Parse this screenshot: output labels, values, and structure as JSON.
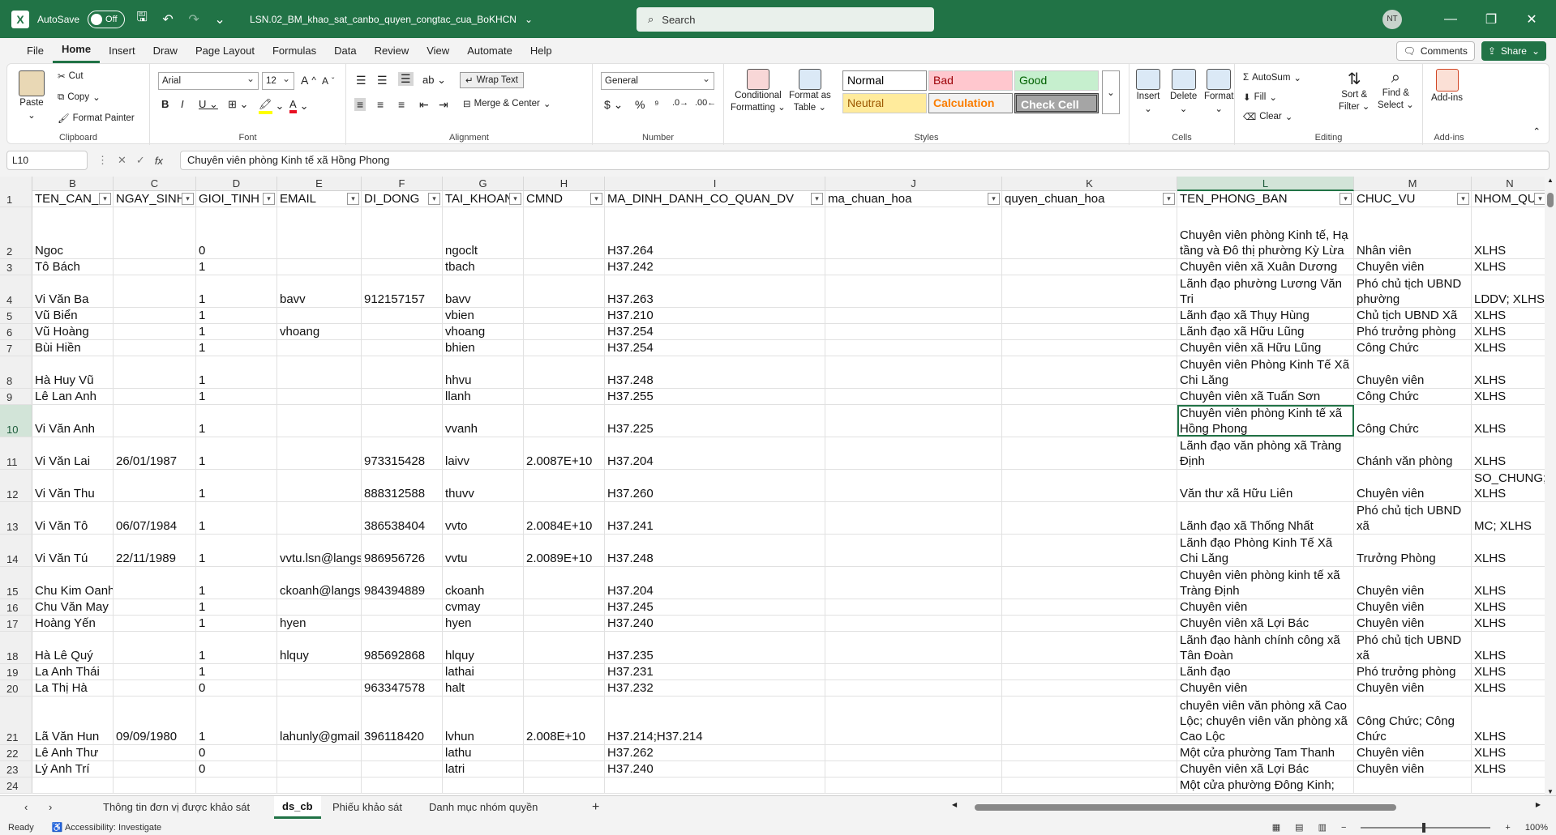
{
  "titlebar": {
    "autosave_label": "AutoSave",
    "autosave_state": "Off",
    "filename": "LSN.02_BM_khao_sat_canbo_quyen_congtac_cua_BoKHCN",
    "search_placeholder": "Search",
    "user_initials": "NT"
  },
  "menu": [
    "File",
    "Home",
    "Insert",
    "Draw",
    "Page Layout",
    "Formulas",
    "Data",
    "Review",
    "View",
    "Automate",
    "Help"
  ],
  "menu_right": {
    "comments": "Comments",
    "share": "Share"
  },
  "ribbon": {
    "clipboard": {
      "paste": "Paste",
      "cut": "Cut",
      "copy": "Copy",
      "format_painter": "Format Painter",
      "label": "Clipboard"
    },
    "font": {
      "name": "Arial",
      "size": "12",
      "label": "Font"
    },
    "alignment": {
      "wrap": "Wrap Text",
      "merge": "Merge & Center",
      "label": "Alignment"
    },
    "number": {
      "format": "General",
      "label": "Number"
    },
    "styles": {
      "conditional": "Conditional",
      "conditional2": "Formatting",
      "format_table": "Format as",
      "format_table2": "Table",
      "normal": "Normal",
      "bad": "Bad",
      "good": "Good",
      "neutral": "Neutral",
      "calculation": "Calculation",
      "check": "Check Cell",
      "label": "Styles"
    },
    "cells": {
      "insert": "Insert",
      "delete": "Delete",
      "format": "Format",
      "label": "Cells"
    },
    "editing": {
      "autosum": "AutoSum",
      "fill": "Fill",
      "clear": "Clear",
      "sort": "Sort &",
      "sort2": "Filter",
      "find": "Find &",
      "find2": "Select",
      "label": "Editing"
    },
    "addins": {
      "addins": "Add-ins",
      "label": "Add-ins"
    },
    "colors": {
      "font_color": "#e81123",
      "highlight": "#ffff00"
    }
  },
  "formula_bar": {
    "name_box": "L10",
    "content": "Chuyên viên phòng Kinh tế xã Hồng Phong"
  },
  "columns": [
    "B",
    "C",
    "D",
    "E",
    "F",
    "G",
    "H",
    "I",
    "J",
    "K",
    "L",
    "M",
    "N"
  ],
  "headers": [
    "TEN_CAN_",
    "NGAY_SINH",
    "GIOI_TINH",
    "EMAIL",
    "DI_DONG",
    "TAI_KHOAN",
    "CMND",
    "MA_DINH_DANH_CO_QUAN_DV",
    "ma_chuan_hoa",
    "quyen_chuan_hoa",
    "TEN_PHONG_BAN",
    "CHUC_VU",
    "NHOM_QU"
  ],
  "rows": [
    {
      "n": "2",
      "c": [
        "Ngoc",
        "",
        "0",
        "",
        "",
        "ngoclt",
        "",
        "H37.264",
        "",
        "",
        "Chuyên viên phòng Kinh tế, Hạ tầng và Đô thị phường Kỳ Lừa",
        "Nhân viên",
        "XLHS"
      ]
    },
    {
      "n": "3",
      "c": [
        "Tô Bách",
        "",
        "1",
        "",
        "",
        "tbach",
        "",
        "H37.242",
        "",
        "",
        "Chuyên viên xã Xuân Dương",
        "Chuyên viên",
        "XLHS"
      ]
    },
    {
      "n": "4",
      "c": [
        "Vi Văn Ba",
        "",
        "1",
        "bavv",
        "912157157",
        "bavv",
        "",
        "H37.263",
        "",
        "",
        "Lãnh đạo phường Lương Văn Tri",
        "Phó chủ tịch UBND phường",
        "LDDV; XLHS"
      ]
    },
    {
      "n": "5",
      "c": [
        "Vũ Biển",
        "",
        "1",
        "",
        "",
        "vbien",
        "",
        "H37.210",
        "",
        "",
        "Lãnh đạo xã Thụy Hùng",
        "Chủ tịch UBND Xã",
        "XLHS"
      ]
    },
    {
      "n": "6",
      "c": [
        "Vũ Hoàng",
        "",
        "1",
        "vhoang",
        "",
        "vhoang",
        "",
        "H37.254",
        "",
        "",
        "Lãnh đạo xã Hữu Lũng",
        "Phó trưởng phòng",
        "XLHS"
      ]
    },
    {
      "n": "7",
      "c": [
        "Bùi Hiền",
        "",
        "1",
        "",
        "",
        "bhien",
        "",
        "H37.254",
        "",
        "",
        "Chuyên viên xã Hữu Lũng",
        "Công Chức",
        "XLHS"
      ]
    },
    {
      "n": "8",
      "c": [
        "Hà Huy Vũ",
        "",
        "1",
        "",
        "",
        "hhvu",
        "",
        "H37.248",
        "",
        "",
        "Chuyên viên Phòng Kinh Tế Xã Chi Lăng",
        "Chuyên viên",
        "XLHS"
      ]
    },
    {
      "n": "9",
      "c": [
        "Lê Lan Anh",
        "",
        "1",
        "",
        "",
        "llanh",
        "",
        "H37.255",
        "",
        "",
        "Chuyên viên xã Tuấn Sơn",
        "Công Chức",
        "XLHS"
      ]
    },
    {
      "n": "10",
      "c": [
        "Vi Văn Anh",
        "",
        "1",
        "",
        "",
        "vvanh",
        "",
        "H37.225",
        "",
        "",
        "Chuyên viên phòng Kinh tế xã Hồng Phong",
        "Công Chức",
        "XLHS"
      ]
    },
    {
      "n": "11",
      "c": [
        "Vi Văn Lai",
        "26/01/1987",
        "1",
        "",
        "973315428",
        "laivv",
        "2.0087E+10",
        "H37.204",
        "",
        "",
        "Lãnh đạo văn phòng xã Tràng Định",
        "Chánh văn phòng",
        "XLHS"
      ]
    },
    {
      "n": "12",
      "c": [
        "Vi Văn Thu",
        "",
        "1",
        "",
        "888312588",
        "thuvv",
        "",
        "H37.260",
        "",
        "",
        "Văn thư xã Hữu Liên",
        "Chuyên viên",
        "SO_CHUNG; XLHS"
      ]
    },
    {
      "n": "13",
      "c": [
        "Vi Văn Tô",
        "06/07/1984",
        "1",
        "",
        "386538404",
        "vvto",
        "2.0084E+10",
        "H37.241",
        "",
        "",
        "Lãnh đạo xã Thống Nhất",
        "Phó chủ tịch UBND xã",
        "MC; XLHS"
      ]
    },
    {
      "n": "14",
      "c": [
        "Vi Văn Tú",
        "22/11/1989",
        "1",
        "vvtu.lsn@langson",
        "986956726",
        "vvtu",
        "2.0089E+10",
        "H37.248",
        "",
        "",
        "Lãnh đạo Phòng Kinh Tế Xã Chi Lăng",
        "Trưởng Phòng",
        "XLHS"
      ]
    },
    {
      "n": "15",
      "c": [
        "Chu Kim Oanh",
        "",
        "1",
        "ckoanh@langson",
        "984394889",
        "ckoanh",
        "",
        "H37.204",
        "",
        "",
        "Chuyên viên phòng kinh tế xã Tràng Định",
        "Chuyên viên",
        "XLHS"
      ]
    },
    {
      "n": "16",
      "c": [
        "Chu Văn May",
        "",
        "1",
        "",
        "",
        "cvmay",
        "",
        "H37.245",
        "",
        "",
        "Chuyên viên",
        "Chuyên viên",
        "XLHS"
      ]
    },
    {
      "n": "17",
      "c": [
        "Hoàng Yến",
        "",
        "1",
        "hyen",
        "",
        "hyen",
        "",
        "H37.240",
        "",
        "",
        "Chuyên viên xã Lợi Bác",
        "Chuyên viên",
        "XLHS"
      ]
    },
    {
      "n": "18",
      "c": [
        "Hà Lê Quý",
        "",
        "1",
        "hlquy",
        "985692868",
        "hlquy",
        "",
        "H37.235",
        "",
        "",
        "Lãnh đạo hành chính công xã Tân Đoàn",
        "Phó chủ tịch UBND xã",
        "XLHS"
      ]
    },
    {
      "n": "19",
      "c": [
        "La Anh Thái",
        "",
        "1",
        "",
        "",
        "lathai",
        "",
        "H37.231",
        "",
        "",
        "Lãnh đạo",
        "Phó trưởng phòng",
        "XLHS"
      ]
    },
    {
      "n": "20",
      "c": [
        "La Thị Hà",
        "",
        "0",
        "",
        "963347578",
        "halt",
        "",
        "H37.232",
        "",
        "",
        "Chuyên viên",
        "Chuyên viên",
        "XLHS"
      ]
    },
    {
      "n": "21",
      "c": [
        "Lã Văn Hun",
        "09/09/1980",
        "1",
        "lahunly@gmail.com",
        "396118420",
        "lvhun",
        "2.008E+10",
        "H37.214;H37.214",
        "",
        "",
        "chuyên viên văn phòng xã Cao Lộc; chuyên viên văn phòng xã Cao Lộc",
        "Công Chức; Công Chức",
        "XLHS"
      ]
    },
    {
      "n": "22",
      "c": [
        "Lê Anh Thư",
        "",
        "0",
        "",
        "",
        "lathu",
        "",
        "H37.262",
        "",
        "",
        "Một cửa phường Tam Thanh",
        "Chuyên viên",
        "XLHS"
      ]
    },
    {
      "n": "23",
      "c": [
        "Lý Anh Trí",
        "",
        "0",
        "",
        "",
        "latri",
        "",
        "H37.240",
        "",
        "",
        "Chuyên viên xã Lợi Bác",
        "Chuyên viên",
        "XLHS"
      ]
    },
    {
      "n": "24",
      "c": [
        "",
        "",
        "",
        "",
        "",
        "",
        "",
        "",
        "",
        "",
        "Một cửa phường Đông Kinh;",
        "",
        ""
      ]
    }
  ],
  "sheets": [
    "Thông tin đơn vị được khảo sát",
    "ds_cb",
    "Phiếu khảo sát",
    "Danh mục nhóm quyền"
  ],
  "active_sheet": "ds_cb",
  "status": {
    "ready": "Ready",
    "accessibility": "Accessibility: Investigate",
    "zoom": "100%"
  }
}
